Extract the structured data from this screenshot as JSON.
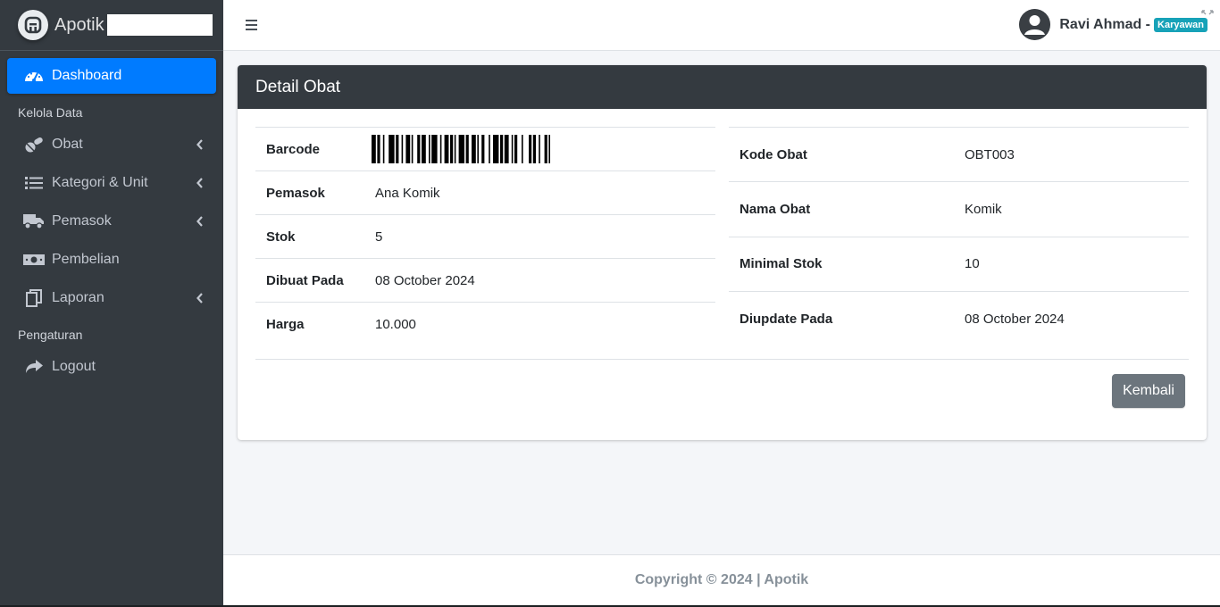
{
  "brand": {
    "name": "Apotik"
  },
  "sidebar": {
    "dashboard": "Dashboard",
    "header_manage": "Kelola Data",
    "items": [
      {
        "label": "Obat",
        "icon": "pills-icon",
        "has_submenu": true
      },
      {
        "label": "Kategori & Unit",
        "icon": "list-icon",
        "has_submenu": true
      },
      {
        "label": "Pemasok",
        "icon": "truck-icon",
        "has_submenu": true
      },
      {
        "label": "Pembelian",
        "icon": "money-bill-icon",
        "has_submenu": false
      },
      {
        "label": "Laporan",
        "icon": "copy-icon",
        "has_submenu": true
      }
    ],
    "header_settings": "Pengaturan",
    "logout": "Logout"
  },
  "topbar": {
    "user_name": "Ravi Ahmad -",
    "role": "Karyawan"
  },
  "card": {
    "title": "Detail Obat",
    "left": {
      "barcode_label": "Barcode",
      "supplier_label": "Pemasok",
      "supplier_value": "Ana Komik",
      "stock_label": "Stok",
      "stock_value": "5",
      "created_label": "Dibuat Pada",
      "created_value": "08 October 2024",
      "price_label": "Harga",
      "price_value": "10.000"
    },
    "right": {
      "code_label": "Kode Obat",
      "code_value": "OBT003",
      "name_label": "Nama Obat",
      "name_value": "Komik",
      "min_stock_label": "Minimal Stok",
      "min_stock_value": "10",
      "updated_label": "Diupdate Pada",
      "updated_value": "08 October 2024"
    },
    "back_button": "Kembali"
  },
  "footer": {
    "text": "Copyright © 2024 | Apotik"
  },
  "colors": {
    "sidebar_bg": "#343a40",
    "active": "#007bff",
    "badge": "#17a2b8",
    "button": "#6c757d"
  }
}
